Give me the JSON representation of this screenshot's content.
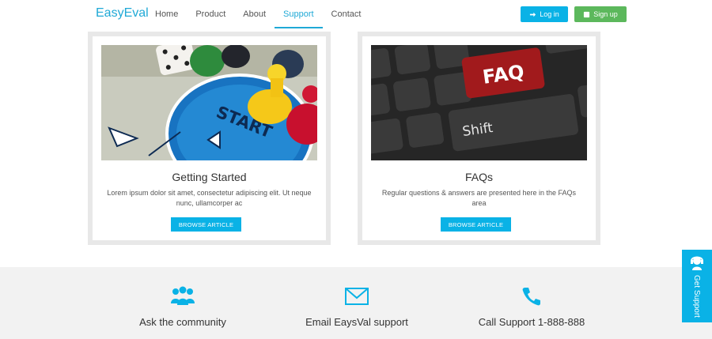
{
  "nav": {
    "brand": "EasyEval",
    "links": [
      "Home",
      "Product",
      "About",
      "Support",
      "Contact"
    ],
    "login_label": "Log in",
    "signup_label": "Sign up"
  },
  "cards": [
    {
      "title": "Getting Started",
      "text": "Lorem ipsum dolor sit amet, consectetur adipiscing elit. Ut neque nunc, ullamcorper ac",
      "button": "BROWSE ARTICLE",
      "image_text": "START"
    },
    {
      "title": "FAQs",
      "text": "Regular questions & answers are presented here in the FAQs area",
      "button": "BROWSE ARTICLE",
      "image_key_faq": "FAQ",
      "image_key_shift": "Shift"
    }
  ],
  "support": [
    {
      "label": "Ask the community",
      "icon": "community-icon"
    },
    {
      "label": "Email EaysVal support",
      "icon": "mail-icon"
    },
    {
      "label": "Call Support 1-888-888",
      "icon": "phone-icon"
    }
  ],
  "side_tab": {
    "label": "Get Support",
    "icon": "headset-icon"
  },
  "colors": {
    "accent": "#0ab2e6",
    "brand": "#1fa9d6",
    "signup": "#5cb85c"
  }
}
